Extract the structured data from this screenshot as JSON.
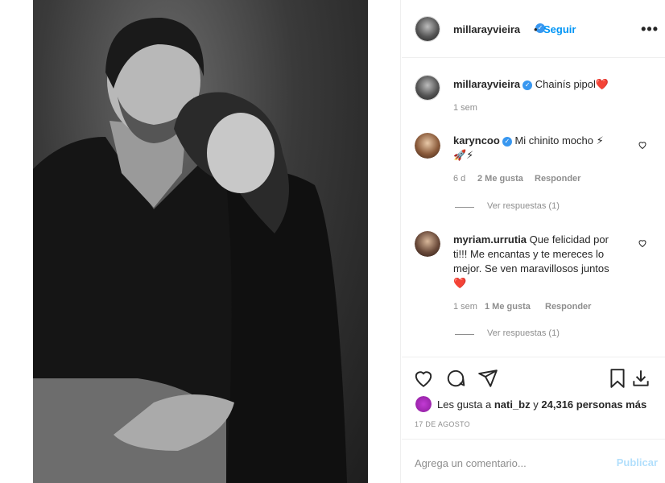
{
  "post": {
    "author": "millarayvieira",
    "follow_label": "Seguir",
    "more_label": "•••",
    "dot_separator": "•"
  },
  "caption": {
    "username": "millarayvieira",
    "text": "Chainís pipol",
    "emoji": "❤️",
    "time": "1 sem"
  },
  "comments": [
    {
      "username": "karyncoo",
      "text": "Mi chinito mocho ⚡",
      "text2": "🚀⚡",
      "time": "6 d",
      "likes": "2 Me gusta",
      "reply_label": "Responder",
      "view_replies": "Ver respuestas (1)"
    },
    {
      "username": "myriam.urrutia",
      "text_line1": "Que felicidad por",
      "text_line2": "ti!!! Me encantas y te mereces lo",
      "text_line3": "mejor. Se ven maravillosos juntos",
      "text_line4": "❤️",
      "time": "1 sem",
      "likes": "1 Me gusta",
      "reply_label": "Responder",
      "view_replies": "Ver respuestas (1)"
    }
  ],
  "likes": {
    "prefix": "Les gusta a",
    "user": "nati_bz",
    "connector": "y",
    "count_text": "24,316 personas más"
  },
  "date": "17 DE AGOSTO",
  "composer": {
    "placeholder": "Agrega un comentario...",
    "publish_label": "Publicar"
  },
  "icons": {
    "like": "heart-icon",
    "comment": "comment-icon",
    "share": "paper-plane-icon",
    "save": "bookmark-icon",
    "download": "download-icon",
    "verified": "verified-badge-icon",
    "more": "more-options-icon"
  },
  "colors": {
    "accent": "#0095f6",
    "verified": "#3897f0",
    "muted": "#8e8e8e",
    "publish_disabled": "#b2dffc",
    "text": "#262626"
  }
}
